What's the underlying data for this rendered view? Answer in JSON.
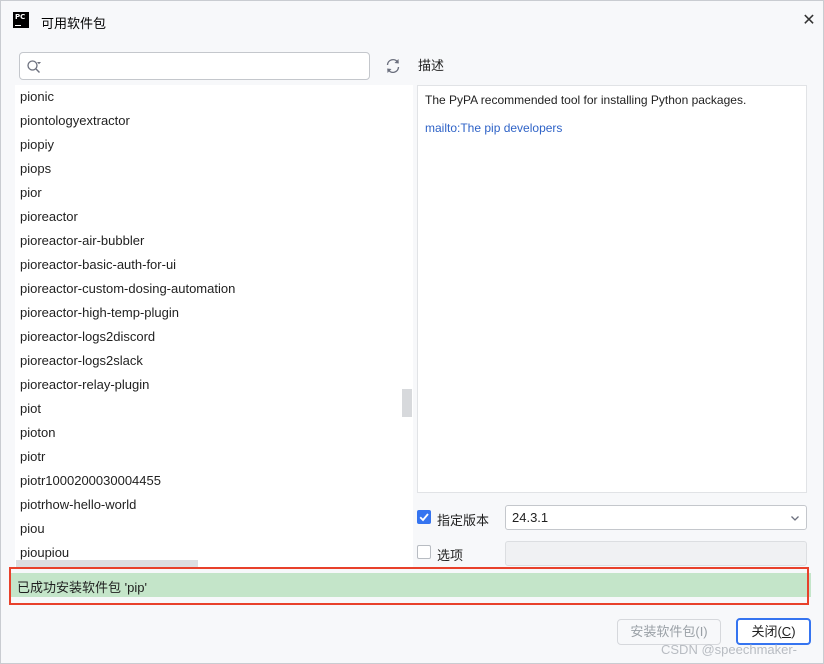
{
  "window": {
    "title": "可用软件包",
    "app_icon_text": "PC",
    "close_glyph": "✕"
  },
  "search": {
    "value": "",
    "placeholder": ""
  },
  "packages": [
    "pionic",
    "piontologyextractor",
    "piopiy",
    "piops",
    "pior",
    "pioreactor",
    "pioreactor-air-bubbler",
    "pioreactor-basic-auth-for-ui",
    "pioreactor-custom-dosing-automation",
    "pioreactor-high-temp-plugin",
    "pioreactor-logs2discord",
    "pioreactor-logs2slack",
    "pioreactor-relay-plugin",
    "piot",
    "pioton",
    "piotr",
    "piotr1000200030004455",
    "piotrhow-hello-world",
    "piou",
    "pioupiou"
  ],
  "description": {
    "label": "描述",
    "text": "The PyPA recommended tool for installing Python packages.",
    "link": "mailto:The pip developers"
  },
  "options": {
    "specify_version_label": "指定版本",
    "specify_version_checked": true,
    "version_value": "24.3.1",
    "options_label": "选项",
    "options_checked": false,
    "options_value": ""
  },
  "status": {
    "message": "已成功安装软件包 'pip'",
    "color": "#c4e5c9",
    "highlight_color": "#e8412b"
  },
  "buttons": {
    "install_label": "安装软件包(I)",
    "close_label_main": "关闭(",
    "close_label_mnemonic": "C",
    "close_label_end": ")"
  },
  "watermark": "CSDN @speechmaker-",
  "colors": {
    "accent": "#3574f0",
    "link": "#2f63c7"
  }
}
